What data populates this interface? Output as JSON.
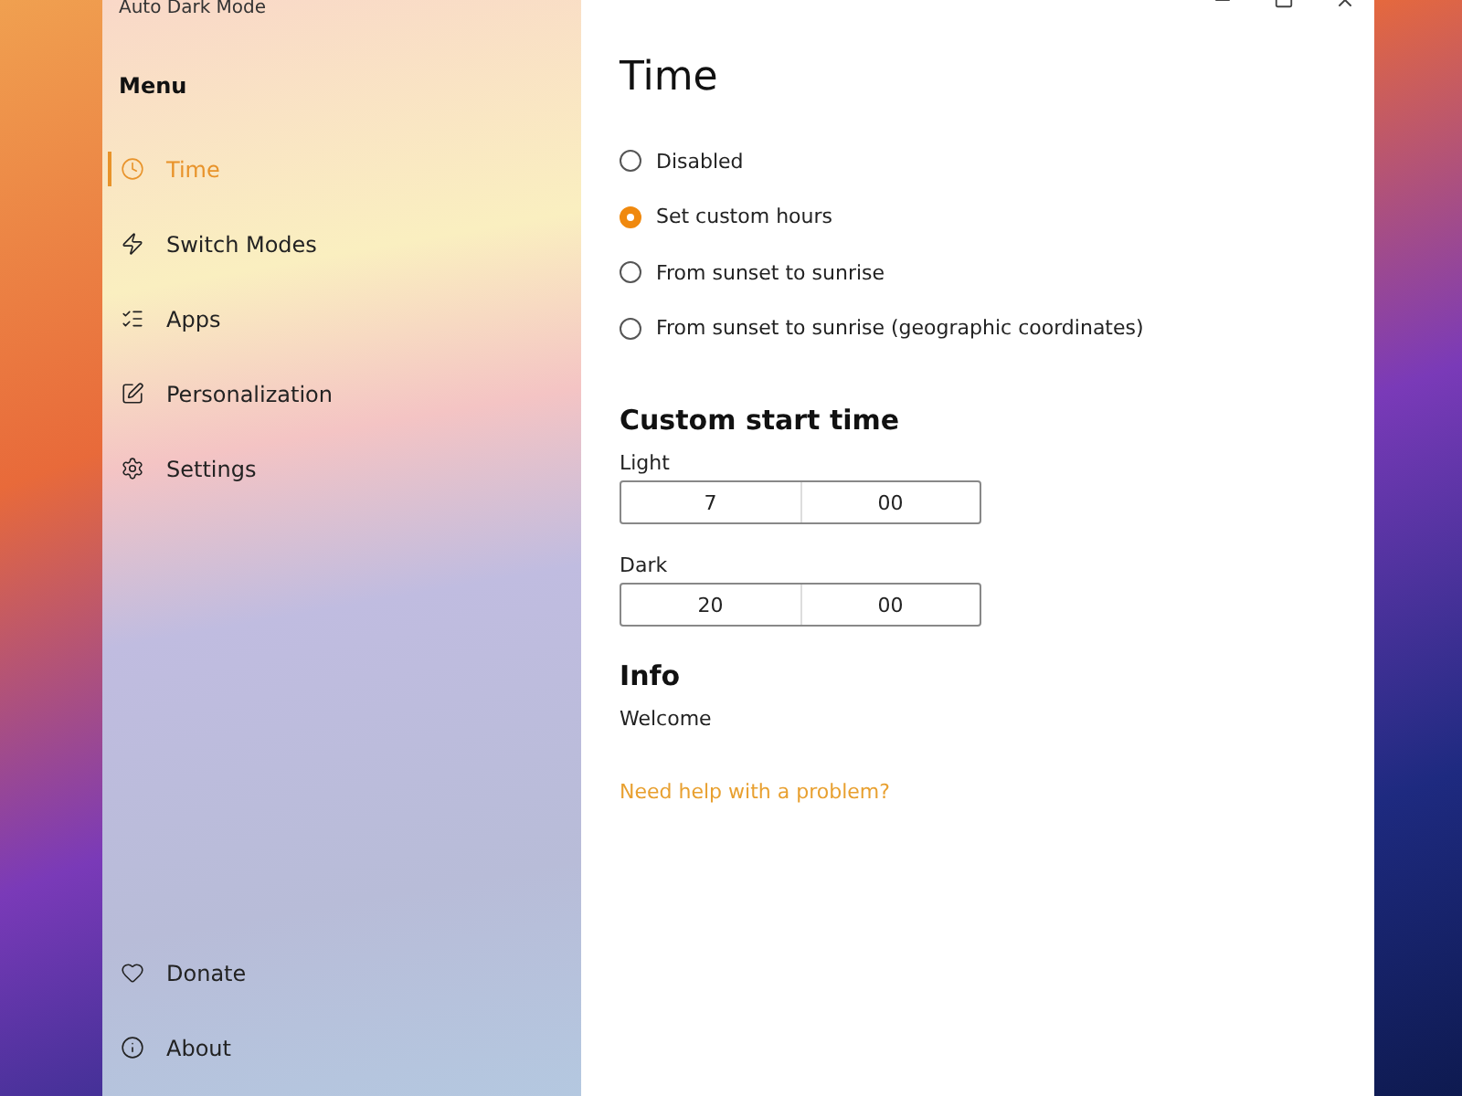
{
  "window": {
    "title": "Auto Dark Mode"
  },
  "sidebar": {
    "heading": "Menu",
    "items": [
      {
        "label": "Time",
        "selected": true
      },
      {
        "label": "Switch Modes",
        "selected": false
      },
      {
        "label": "Apps",
        "selected": false
      },
      {
        "label": "Personalization",
        "selected": false
      },
      {
        "label": "Settings",
        "selected": false
      }
    ],
    "footer_items": [
      {
        "label": "Donate",
        "selected": false
      },
      {
        "label": "About",
        "selected": false
      }
    ]
  },
  "page": {
    "title": "Time",
    "options": [
      {
        "label": "Disabled",
        "selected": false
      },
      {
        "label": "Set custom hours",
        "selected": true
      },
      {
        "label": "From sunset to sunrise",
        "selected": false
      },
      {
        "label": "From sunset to sunrise (geographic coordinates)",
        "selected": false
      }
    ],
    "custom_heading": "Custom start time",
    "times": [
      {
        "label": "Light",
        "hour": "7",
        "minute": "00"
      },
      {
        "label": "Dark",
        "hour": "20",
        "minute": "00"
      }
    ],
    "info_heading": "Info",
    "info_text": "Welcome",
    "help_link": "Need help with a problem?"
  }
}
